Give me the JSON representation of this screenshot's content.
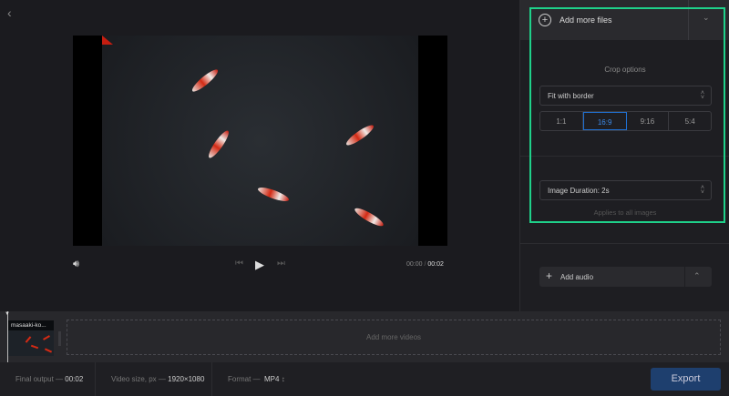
{
  "nav": {
    "back_icon": "chevron-left-icon"
  },
  "player": {
    "current_time": "00:00",
    "separator": "/",
    "total_time": "00:02"
  },
  "panel": {
    "add_files_label": "Add more files",
    "crop_title": "Crop options",
    "crop_mode": "Fit with border",
    "ratios": [
      "1:1",
      "16:9",
      "9:16",
      "5:4"
    ],
    "active_ratio": "16:9",
    "image_duration": "Image Duration: 2s",
    "applies_note": "Applies to all images",
    "add_audio_label": "Add audio",
    "highlight_color": "#1fd18a"
  },
  "timeline": {
    "clip_name": "masaaki-ko...",
    "add_videos_label": "Add more videos"
  },
  "footer": {
    "final_output_label": "Final output —",
    "final_output_value": "00:02",
    "size_label": "Video size, px —",
    "size_value": "1920×1080",
    "format_label": "Format —",
    "format_value": "MP4",
    "export_label": "Export",
    "export_color": "#1e3f6e"
  }
}
